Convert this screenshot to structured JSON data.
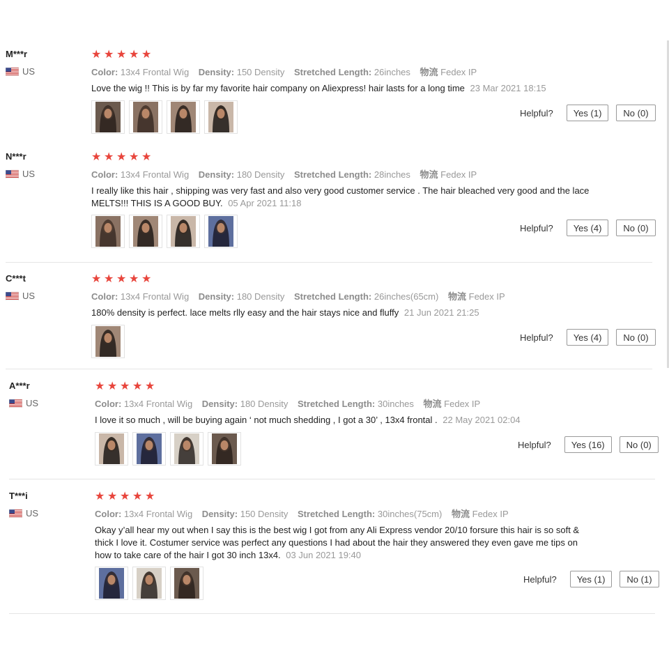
{
  "attr_labels": {
    "color": "Color:",
    "density": "Density:",
    "length": "Stretched Length:",
    "shipping": "物流"
  },
  "helpful_label": "Helpful?",
  "reviews": [
    {
      "user": "M***r",
      "country": "US",
      "stars": 5,
      "color": "13x4 Frontal Wig",
      "density": "150 Density",
      "length": "26inches",
      "shipping": "Fedex IP",
      "text": "Love the wig !! This is by far my favorite hair company on Aliexpress! hair lasts for a long time",
      "date": "23 Mar 2021 18:15",
      "photo_count": 4,
      "yes": "Yes (1)",
      "no": "No (0)"
    },
    {
      "user": "N***r",
      "country": "US",
      "stars": 5,
      "color": "13x4 Frontal Wig",
      "density": "180 Density",
      "length": "28inches",
      "shipping": "Fedex IP",
      "text": "I really like this hair , shipping was very fast and also very good customer service . The hair bleached very good and the lace MELTS!!! THIS IS A GOOD BUY.",
      "date": "05 Apr 2021 11:18",
      "photo_count": 4,
      "yes": "Yes (4)",
      "no": "No (0)"
    },
    {
      "user": "C***t",
      "country": "US",
      "stars": 5,
      "color": "13x4 Frontal Wig",
      "density": "180 Density",
      "length": "26inches(65cm)",
      "shipping": "Fedex IP",
      "text": "180% density is perfect. lace melts rlly easy and the hair stays nice and fluffy",
      "date": "21 Jun 2021 21:25",
      "photo_count": 1,
      "yes": "Yes (4)",
      "no": "No (0)"
    },
    {
      "user": "A***r",
      "country": "US",
      "stars": 5,
      "color": "13x4 Frontal Wig",
      "density": "180 Density",
      "length": "30inches",
      "shipping": "Fedex IP",
      "text": "I love it so much , will be buying again ‘ not much shedding , I got a 30’ , 13x4 frontal .",
      "date": "22 May 2021 02:04",
      "photo_count": 4,
      "yes": "Yes (16)",
      "no": "No (0)"
    },
    {
      "user": "T***i",
      "country": "US",
      "stars": 5,
      "color": "13x4 Frontal Wig",
      "density": "150 Density",
      "length": "30inches(75cm)",
      "shipping": "Fedex IP",
      "text": "Okay y’all hear my out when I say this is the best wig I got from any Ali Express vendor 20/10 forsure this hair is so soft & thick I love it. Costumer service was perfect any questions I had about the hair they answered they even gave me tips on how to take care of the hair I got 30 inch 13x4.",
      "date": "03 Jun 2021 19:40",
      "photo_count": 3,
      "yes": "Yes (1)",
      "no": "No (1)"
    }
  ]
}
